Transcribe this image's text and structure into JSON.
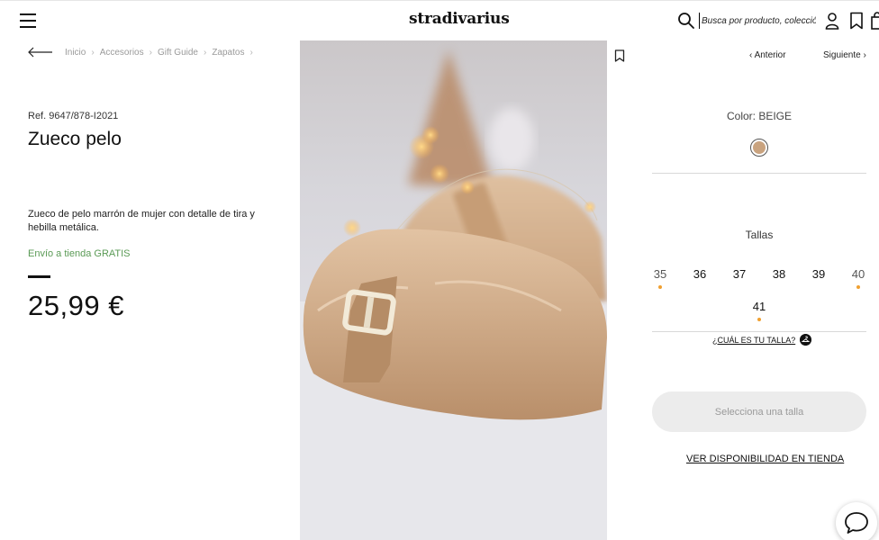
{
  "header": {
    "logo": "stradivarius",
    "search_placeholder": "Busca por producto, colección..."
  },
  "breadcrumb": [
    "Inicio",
    "Accesorios",
    "Gift Guide",
    "Zapatos"
  ],
  "product": {
    "ref": "Ref. 9647/878-I2021",
    "title": "Zueco pelo",
    "description": "Zueco de pelo marrón de mujer con detalle de tira y hebilla metálica.",
    "shipping": "Envío a tienda GRATIS",
    "price": "25,99 €"
  },
  "nav": {
    "prev": "Anterior",
    "next": "Siguiente"
  },
  "color": {
    "label": "Color: BEIGE",
    "swatch_hex": "#c9a37f"
  },
  "sizes": {
    "label": "Tallas",
    "items": [
      {
        "value": "35",
        "low_stock": true
      },
      {
        "value": "36",
        "low_stock": false
      },
      {
        "value": "37",
        "low_stock": false
      },
      {
        "value": "38",
        "low_stock": false
      },
      {
        "value": "39",
        "low_stock": false
      },
      {
        "value": "40",
        "low_stock": true
      },
      {
        "value": "41",
        "low_stock": true
      }
    ],
    "guide_link": "¿CUÁL ES TU TALLA?"
  },
  "actions": {
    "select_size": "Selecciona una talla",
    "store_availability": "VER DISPONIBILIDAD EN TIENDA"
  },
  "colors": {
    "shipping_green": "#5a9a55",
    "low_stock_dot": "#f0a030"
  }
}
